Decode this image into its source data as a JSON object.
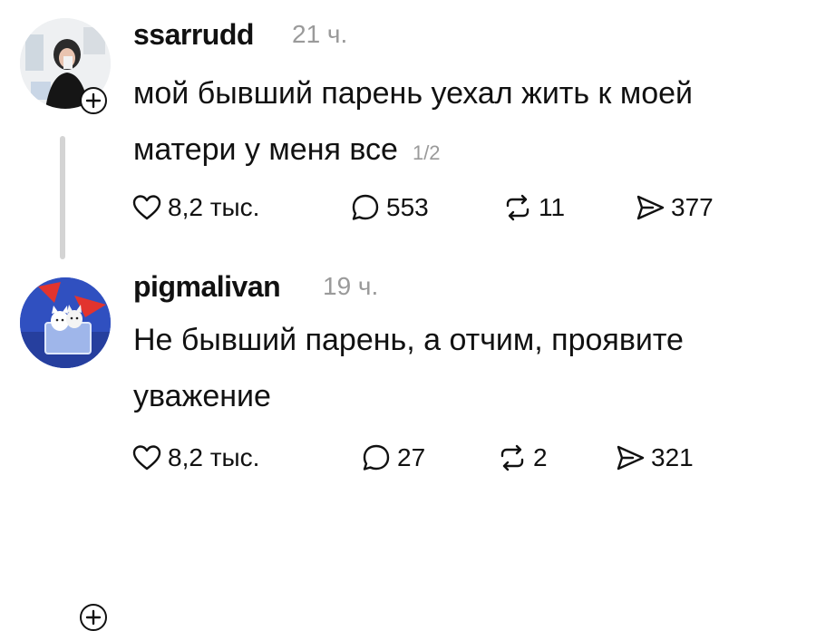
{
  "posts": [
    {
      "username": "ssarrudd",
      "time": "21 ч.",
      "text": "мой бывший парень уехал жить к моей матери у меня все",
      "pager": "1/2",
      "likes": "8,2 тыс.",
      "replies": "553",
      "reposts": "11",
      "shares": "377"
    },
    {
      "username": "pigmalivan",
      "time": "19 ч.",
      "text": "Не бывший парень, а отчим, проявите уважение",
      "likes": "8,2 тыс.",
      "replies": "27",
      "reposts": "2",
      "shares": "321"
    }
  ],
  "icons": {
    "like": "heart-icon",
    "reply": "speech-bubble-icon",
    "repost": "repost-icon",
    "share": "send-icon",
    "follow": "plus-icon"
  }
}
